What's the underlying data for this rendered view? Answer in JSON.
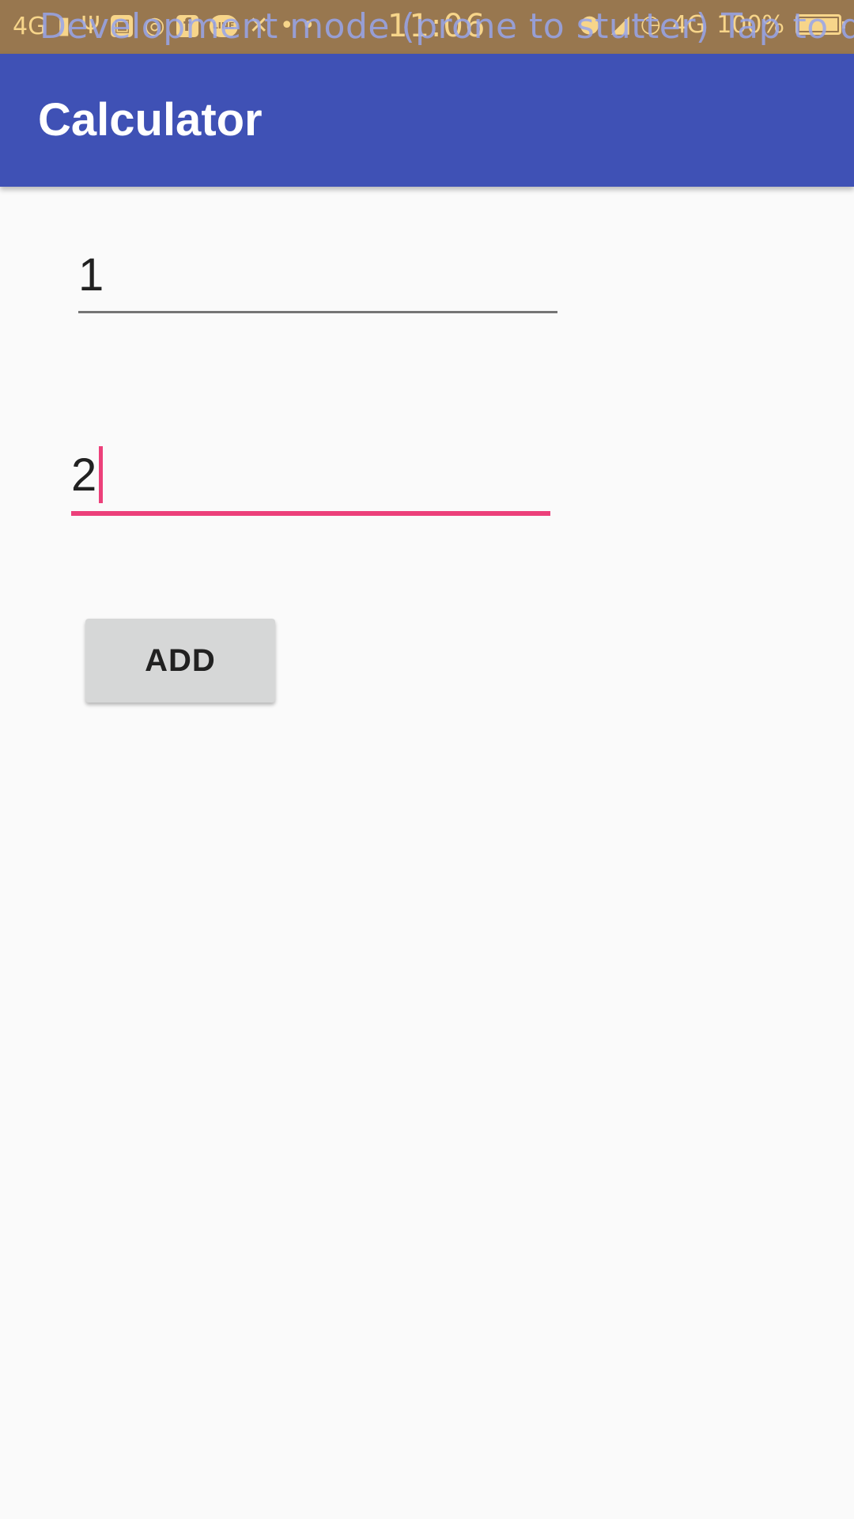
{
  "status_bar": {
    "network_label": "4G",
    "signal_icon": "signal-bars-icon",
    "usb_icon": "usb-icon",
    "app_icons": [
      "photo-app-icon",
      "hotspot-icon",
      "facebook-icon",
      "line-icon",
      "tools-icon"
    ],
    "line_label": "LINE",
    "more_dots": "• •",
    "time": "11:06",
    "right_network_label": "4G",
    "battery_label": "100%",
    "background_color": "#98774f",
    "icon_color": "#f7d58a"
  },
  "dev_overlay": {
    "text": "Development mode (prone to stutter) Tap to disable."
  },
  "app_bar": {
    "title": "Calculator",
    "color": "#3f51b5"
  },
  "form": {
    "first_number": "1",
    "second_number": "2",
    "active_underline_color": "#ec407a",
    "add_label": "ADD"
  }
}
